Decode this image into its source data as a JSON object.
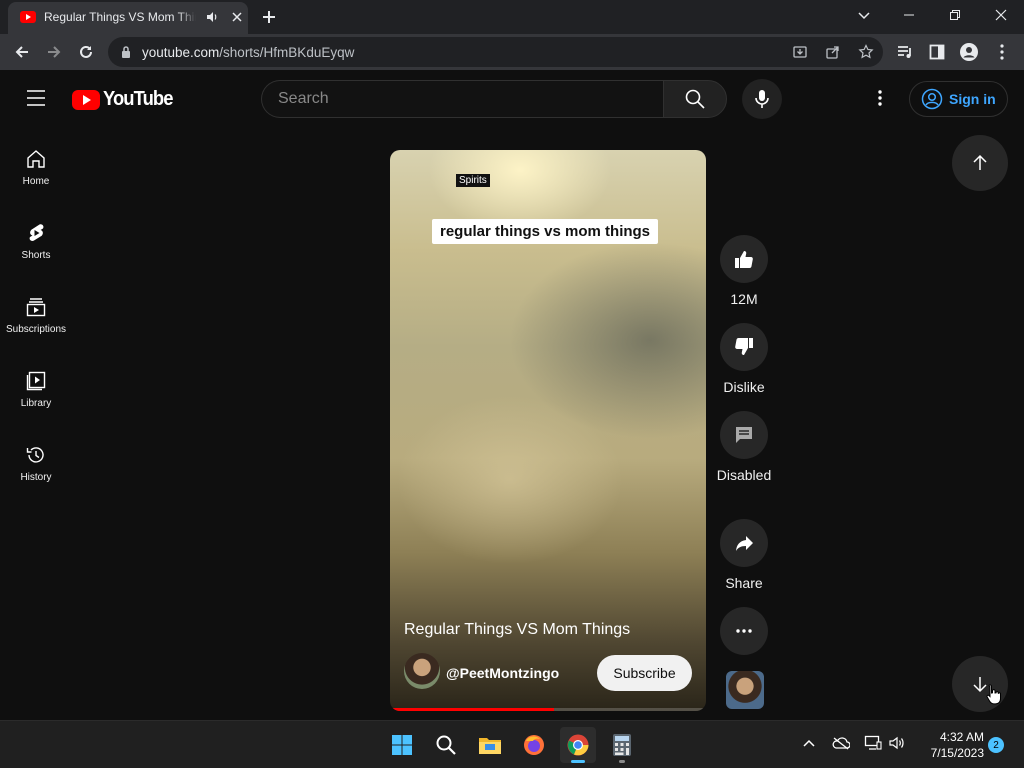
{
  "browser": {
    "tab_title": "Regular Things VS Mom Things - YouTube",
    "url_host": "youtube.com",
    "url_path": "/shorts/HfmBKduEyqw"
  },
  "header": {
    "logo_text": "YouTube",
    "search_placeholder": "Search",
    "signin_label": "Sign in"
  },
  "sidebar": {
    "items": [
      {
        "label": "Home",
        "icon": "home-icon"
      },
      {
        "label": "Shorts",
        "icon": "shorts-icon"
      },
      {
        "label": "Subscriptions",
        "icon": "subscriptions-icon"
      },
      {
        "label": "Library",
        "icon": "library-icon"
      },
      {
        "label": "History",
        "icon": "history-icon"
      }
    ]
  },
  "short": {
    "sticker_text": "Spirits",
    "caption_text": "regular things vs mom things",
    "title": "Regular Things VS Mom Things",
    "channel": "@PeetMontzingo",
    "subscribe_label": "Subscribe",
    "progress": 0.52
  },
  "actions": {
    "like_count": "12M",
    "dislike_label": "Dislike",
    "comments_label": "Disabled",
    "share_label": "Share"
  },
  "taskbar": {
    "time": "4:32 AM",
    "date": "7/15/2023",
    "notification_count": "2"
  },
  "colors": {
    "brand_red": "#ff0000",
    "link_blue": "#3ea6ff",
    "background": "#0f0f0f"
  }
}
